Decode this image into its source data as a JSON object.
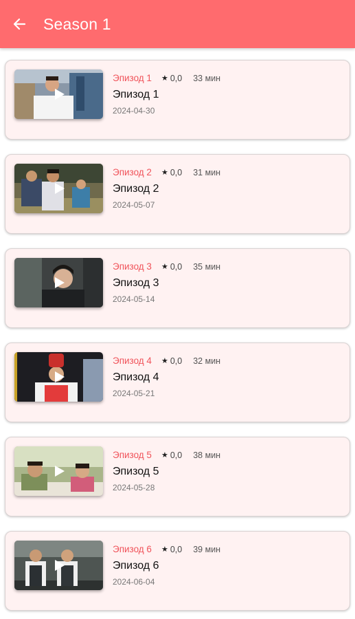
{
  "header": {
    "title": "Season 1",
    "back_icon": "arrow-left-icon",
    "background": "#ff6b6e"
  },
  "episodes": [
    {
      "label": "Эпизод 1",
      "rating": "0,0",
      "duration": "33 мин",
      "title": "Эпизод 1",
      "date": "2024-04-30"
    },
    {
      "label": "Эпизод 2",
      "rating": "0,0",
      "duration": "31 мин",
      "title": "Эпизод 2",
      "date": "2024-05-07"
    },
    {
      "label": "Эпизод 3",
      "rating": "0,0",
      "duration": "35 мин",
      "title": "Эпизод 3",
      "date": "2024-05-14"
    },
    {
      "label": "Эпизод 4",
      "rating": "0,0",
      "duration": "32 мин",
      "title": "Эпизод 4",
      "date": "2024-05-21"
    },
    {
      "label": "Эпизод 5",
      "rating": "0,0",
      "duration": "38 мин",
      "title": "Эпизод 5",
      "date": "2024-05-28"
    },
    {
      "label": "Эпизод 6",
      "rating": "0,0",
      "duration": "39 мин",
      "title": "Эпизод 6",
      "date": "2024-06-04"
    }
  ],
  "colors": {
    "accent": "#f0535a",
    "card_bg": "#fff2f2"
  },
  "icons": {
    "star": "star-icon",
    "play": "play-icon"
  }
}
